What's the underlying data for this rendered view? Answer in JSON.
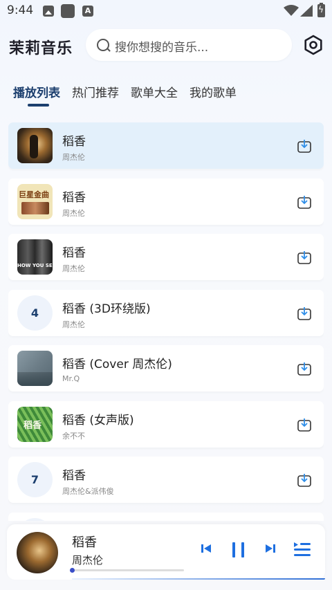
{
  "status": {
    "time": "9:44"
  },
  "header": {
    "app_title": "茉莉音乐",
    "search_placeholder": "搜你想搜的音乐..."
  },
  "tabs": [
    "播放列表",
    "热门推荐",
    "歌单大全",
    "我的歌单"
  ],
  "songs": [
    {
      "title": "稻香",
      "artist": "周杰伦",
      "cover_text": ""
    },
    {
      "title": "稻香",
      "artist": "周杰伦",
      "cover_text": "巨星金曲"
    },
    {
      "title": "稻香",
      "artist": "周杰伦",
      "cover_text": "HOW YOU SEE ME"
    },
    {
      "title": "稻香 (3D环绕版)",
      "artist": "周杰伦",
      "index": "4"
    },
    {
      "title": "稻香 (Cover 周杰伦)",
      "artist": "Mr.Q",
      "cover_text": ""
    },
    {
      "title": "稻香 (女声版)",
      "artist": "余不不",
      "cover_text": "稻香"
    },
    {
      "title": "稻香",
      "artist": "周杰伦&派伟俊",
      "index": "7"
    }
  ],
  "player": {
    "title": "稻香",
    "artist": "周杰伦",
    "progress": 0.0
  },
  "colors": {
    "accent": "#1c3f6e",
    "player_accent": "#2f6fd6",
    "current_row": "#e3f0fb"
  },
  "icons": [
    "search-icon",
    "settings-icon",
    "download-icon",
    "prev-icon",
    "pause-icon",
    "next-icon",
    "playlist-icon"
  ]
}
